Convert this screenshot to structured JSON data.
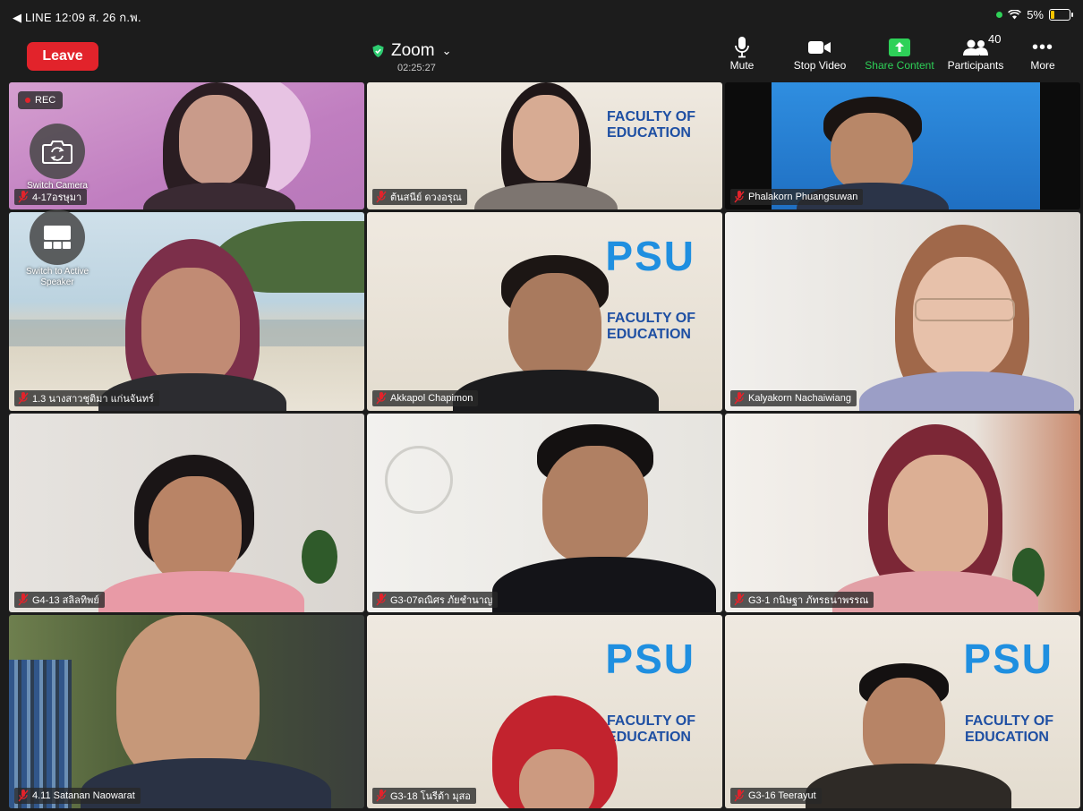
{
  "status_bar": {
    "left": "◀ LINE  12:09  ส. 26 ก.พ.",
    "battery": "5%"
  },
  "toolbar": {
    "leave_label": "Leave",
    "meeting_title": "Zoom",
    "meeting_time": "02:25:27",
    "mute_label": "Mute",
    "stop_video_label": "Stop Video",
    "share_label": "Share Content",
    "participants_label": "Participants",
    "participants_count": "40",
    "more_label": "More"
  },
  "overlay": {
    "rec_label": "REC",
    "switch_camera_label": "Switch Camera",
    "switch_speaker_label": "Switch to Active Speaker"
  },
  "participants": [
    {
      "name": "4-17อรษุมา"
    },
    {
      "name": "ต้นสนีย์ ดวงอรุณ"
    },
    {
      "name": "Phalakorn Phuangsuwan"
    },
    {
      "name": "1.3 นางสาวชุติมา แก่นจันทร์"
    },
    {
      "name": "Akkapol Chapimon"
    },
    {
      "name": "Kalyakorn Nachaiwiang"
    },
    {
      "name": "G4-13 สลิลทิพย์"
    },
    {
      "name": "G3-07ดณิศร ภัยชำนาญ"
    },
    {
      "name": "G3-1 กนิษฐา ภัทรธนาพรรณ"
    },
    {
      "name": "4.11 Satanan Naowarat"
    },
    {
      "name": "G3-18 โนรีด้า มุสอ"
    },
    {
      "name": "G3-16 Teerayut"
    }
  ]
}
